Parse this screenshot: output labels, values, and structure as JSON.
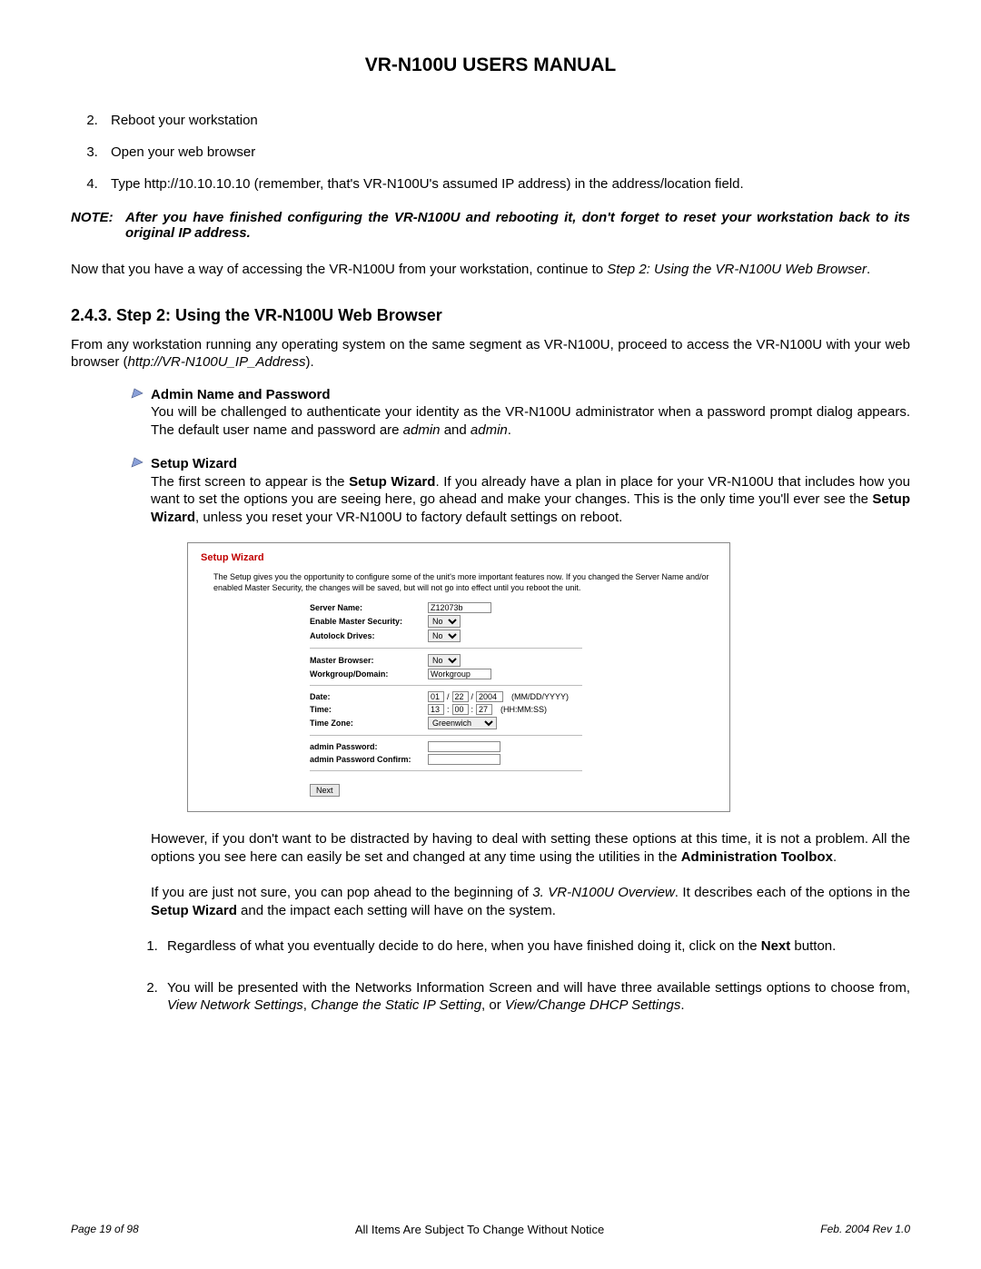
{
  "doc_title": "VR-N100U USERS MANUAL",
  "top_steps_start": 2,
  "top_steps": [
    "Reboot your workstation",
    "Open your web browser",
    "Type http://10.10.10.10 (remember, that's VR-N100U's assumed IP address) in the address/location field."
  ],
  "note_label": "NOTE:",
  "note_body": "After you have finished configuring the VR-N100U and rebooting it, don't forget to reset your workstation back to its original IP address.",
  "after_note_1": "Now that you have a way of accessing the VR-N100U from your workstation, continue to ",
  "after_note_link": "Step 2: Using the VR-N100U Web Browser",
  "after_note_2": ".",
  "section_heading": "2.4.3.  Step 2: Using the VR-N100U Web Browser",
  "section_intro_1": "From any workstation running any operating system on the same segment as VR-N100U, proceed to access the VR-N100U with your web browser (",
  "section_intro_url": "http://VR-N100U_IP_Address",
  "section_intro_2": ").",
  "bullets": [
    {
      "title": "Admin Name and Password",
      "body_parts": [
        {
          "t": "You will be challenged to authenticate your identity as the VR-N100U administrator when a password prompt dialog appears. The default user name and password are "
        },
        {
          "t": "admin",
          "i": true
        },
        {
          "t": " and "
        },
        {
          "t": "admin",
          "i": true
        },
        {
          "t": "."
        }
      ]
    },
    {
      "title": "Setup Wizard",
      "body_parts": [
        {
          "t": "The first screen to appear is the "
        },
        {
          "t": "Setup Wizard",
          "b": true
        },
        {
          "t": ". If you already have a plan in place for your VR-N100U that includes how you want to set the options you are seeing here, go ahead and make your changes. This is the only time you'll ever see the "
        },
        {
          "t": "Setup Wizard",
          "b": true
        },
        {
          "t": ", unless you reset your VR-N100U to factory default settings on reboot."
        }
      ]
    }
  ],
  "wizard": {
    "title": "Setup Wizard",
    "intro": "The Setup gives you the opportunity to configure some of the unit's more important features now. If you changed the Server Name and/or enabled Master Security, the changes will be saved, but will not go into effect until you reboot the unit.",
    "server_name_label": "Server Name:",
    "server_name_value": "Z12073b",
    "enable_master_label": "Enable Master Security:",
    "enable_master_value": "No",
    "autolock_label": "Autolock Drives:",
    "autolock_value": "No",
    "master_browser_label": "Master Browser:",
    "master_browser_value": "No",
    "workgroup_label": "Workgroup/Domain:",
    "workgroup_value": "Workgroup",
    "date_label": "Date:",
    "date_mm": "01",
    "date_dd": "22",
    "date_yyyy": "2004",
    "date_hint": "(MM/DD/YYYY)",
    "time_label": "Time:",
    "time_hh": "13",
    "time_mm": "00",
    "time_ss": "27",
    "time_hint": "(HH:MM:SS)",
    "tz_label": "Time Zone:",
    "tz_value": "Greenwich",
    "pw_label": "admin Password:",
    "pw_confirm_label": "admin Password Confirm:",
    "next_label": "Next"
  },
  "after_wizard_paras": [
    [
      {
        "t": "However, if you don't want to be distracted by having to deal with setting these options at this time, it is not a problem. All the options you see here can easily be set and changed at any time using the utilities in the "
      },
      {
        "t": "Administration Toolbox",
        "b": true
      },
      {
        "t": "."
      }
    ],
    [
      {
        "t": "If you are just not sure, you can pop ahead to the beginning of "
      },
      {
        "t": "3. VR-N100U Overview",
        "i": true
      },
      {
        "t": ". It describes each of the options in the "
      },
      {
        "t": "Setup Wizard",
        "b": true
      },
      {
        "t": " and the impact each setting will have on the system."
      }
    ]
  ],
  "instr_list": [
    [
      {
        "t": "Regardless of what you eventually decide to do here, when you have finished doing it, click on the "
      },
      {
        "t": "Next",
        "b": true
      },
      {
        "t": " button."
      }
    ],
    [
      {
        "t": "You will be presented with the Networks Information Screen and will have three available settings options to choose from, "
      },
      {
        "t": "View Network Settings",
        "i": true
      },
      {
        "t": ", "
      },
      {
        "t": "Change the Static IP Setting",
        "i": true
      },
      {
        "t": ", or "
      },
      {
        "t": "View/Change DHCP Settings",
        "i": true
      },
      {
        "t": "."
      }
    ]
  ],
  "footer": {
    "left": "Page 19 of 98",
    "mid": "All Items Are Subject To Change Without Notice",
    "right": "Feb. 2004 Rev 1.0"
  }
}
